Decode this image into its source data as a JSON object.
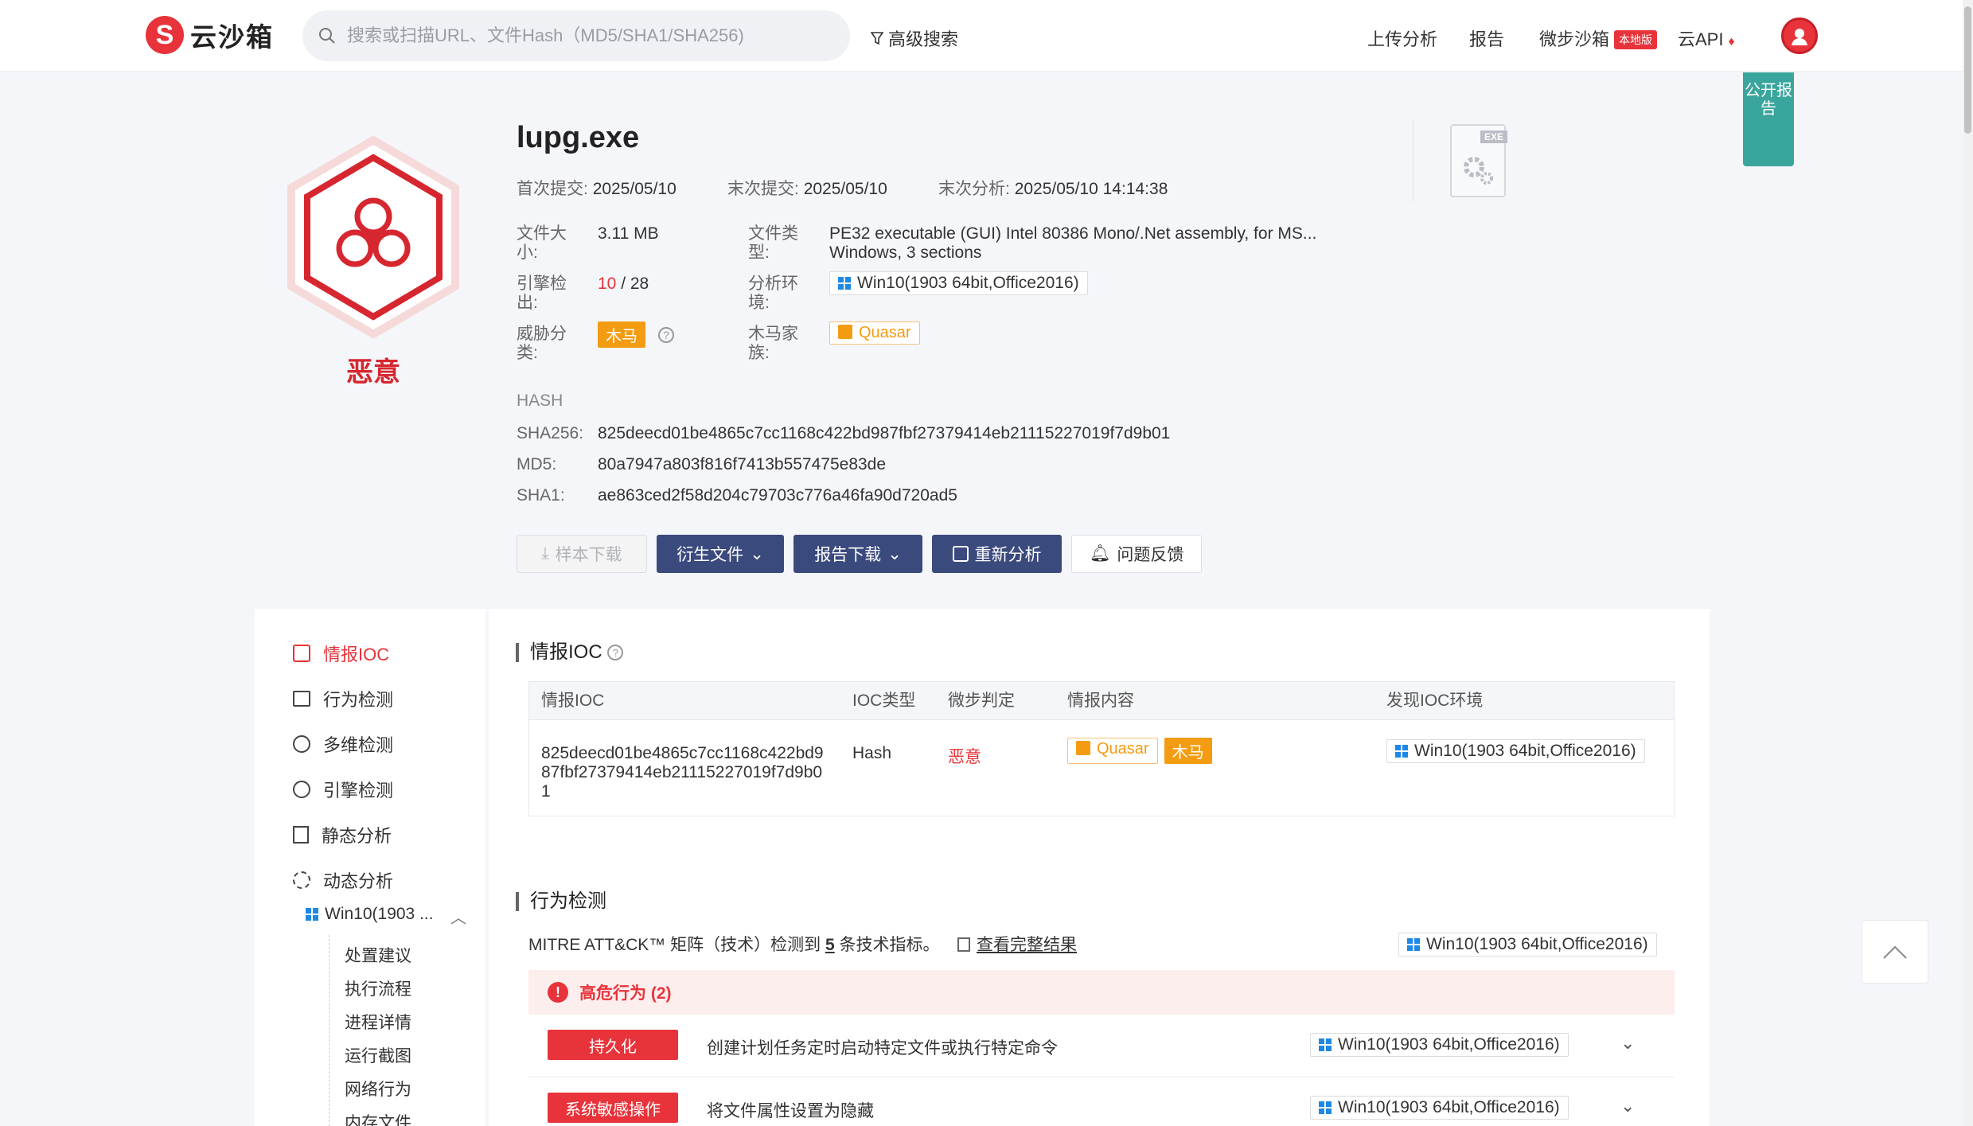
{
  "header": {
    "logo_text": "云沙箱",
    "search_placeholder": "搜索或扫描URL、文件Hash（MD5/SHA1/SHA256)",
    "advanced_search": "高级搜索",
    "nav": [
      "上传分析",
      "报告",
      "微步沙箱",
      "云API"
    ],
    "local_badge": "本地版"
  },
  "public_report": "公开报告",
  "file": {
    "name": "lupg.exe",
    "verdict": "恶意",
    "first_submit_label": "首次提交:",
    "first_submit": "2025/05/10",
    "last_submit_label": "末次提交:",
    "last_submit": "2025/05/10",
    "last_analysis_label": "末次分析:",
    "last_analysis": "2025/05/10 14:14:38",
    "size_label": "文件大小:",
    "size": "3.11 MB",
    "type_label": "文件类型:",
    "type": "PE32 executable (GUI) Intel 80386 Mono/.Net assembly, for MS... Windows, 3 sections",
    "engine_label": "引擎检出:",
    "engine_hits": "10",
    "engine_total": "/ 28",
    "env_label": "分析环境:",
    "env": "Win10(1903 64bit,Office2016)",
    "threat_label": "威胁分类:",
    "threat": "木马",
    "family_label": "木马家族:",
    "family": "Quasar",
    "hash_title": "HASH",
    "sha256_label": "SHA256:",
    "sha256": "825deecd01be4865c7cc1168c422bd987fbf27379414eb21115227019f7d9b01",
    "md5_label": "MD5:",
    "md5": "80a7947a803f816f7413b557475e83de",
    "sha1_label": "SHA1:",
    "sha1": "ae863ced2f58d204c79703c776a46fa90d720ad5",
    "exe_icon_label": "EXE"
  },
  "actions": [
    "样本下载",
    "衍生文件",
    "报告下载",
    "重新分析",
    "问题反馈"
  ],
  "sidebar": {
    "items": [
      "情报IOC",
      "行为检测",
      "多维检测",
      "引擎检测",
      "静态分析",
      "动态分析"
    ],
    "env_item": "Win10(1903 ...",
    "sub_items": [
      "处置建议",
      "执行流程",
      "进程详情",
      "运行截图",
      "网络行为",
      "内存文件"
    ]
  },
  "ioc": {
    "title": "情报IOC",
    "columns": [
      "情报IOC",
      "IOC类型",
      "微步判定",
      "情报内容",
      "发现IOC环境"
    ],
    "rows": [
      {
        "ioc": "825deecd01be4865c7cc1168c422bd987fbf27379414eb21115227019f7d9b01",
        "type": "Hash",
        "verdict": "恶意",
        "family": "Quasar",
        "threat": "木马",
        "env": "Win10(1903 64bit,Office2016)"
      }
    ]
  },
  "behavior": {
    "title": "行为检测",
    "mitre_prefix": "MITRE ATT&CK™ 矩阵（技术）检测到",
    "mitre_count": "5",
    "mitre_suffix": "条技术指标。",
    "view_full": "查看完整结果",
    "env": "Win10(1903 64bit,Office2016)",
    "high_risk": "高危行为 (2)",
    "rows": [
      {
        "tag": "持久化",
        "desc": "创建计划任务定时启动特定文件或执行特定命令",
        "env": "Win10(1903 64bit,Office2016)"
      },
      {
        "tag": "系统敏感操作",
        "desc": "将文件属性设置为隐藏",
        "env": "Win10(1903 64bit,Office2016)"
      }
    ]
  },
  "colors": {
    "accent": "#e8333a",
    "navy": "#3b4a7d",
    "orange": "#f39c12",
    "teal": "#3aa59c"
  }
}
